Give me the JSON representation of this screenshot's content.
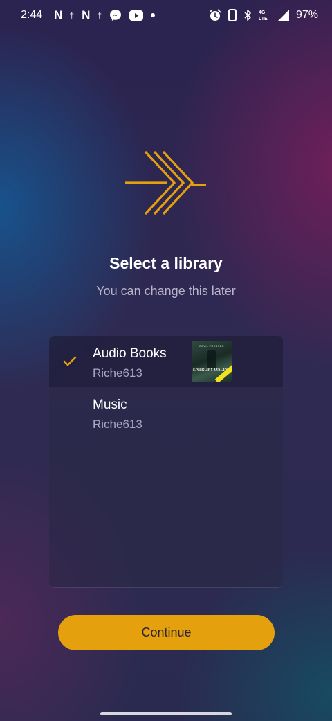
{
  "status_bar": {
    "time": "2:44",
    "notification_icons": [
      "netflix-icon",
      "cross-icon",
      "netflix-icon",
      "cross-icon",
      "messenger-icon",
      "youtube-icon",
      "dot-icon"
    ],
    "netflix_glyph": "N",
    "cross_glyph": "†",
    "battery": "97%",
    "network": "4G LTE"
  },
  "header": {
    "title": "Select a library",
    "subtitle": "You can change this later"
  },
  "libraries": [
    {
      "name": "Audio Books",
      "owner": "Riche613",
      "selected": true,
      "has_cover": true
    },
    {
      "name": "Music",
      "owner": "Riche613",
      "selected": false,
      "has_cover": false
    }
  ],
  "cover": {
    "top_text": "DEVIL PRESSER",
    "title_text": "ENTROPY ONLINE"
  },
  "actions": {
    "continue_label": "Continue"
  },
  "colors": {
    "accent": "#e5a00d",
    "text_primary": "#ffffff",
    "text_secondary": "#b9b3cc"
  }
}
